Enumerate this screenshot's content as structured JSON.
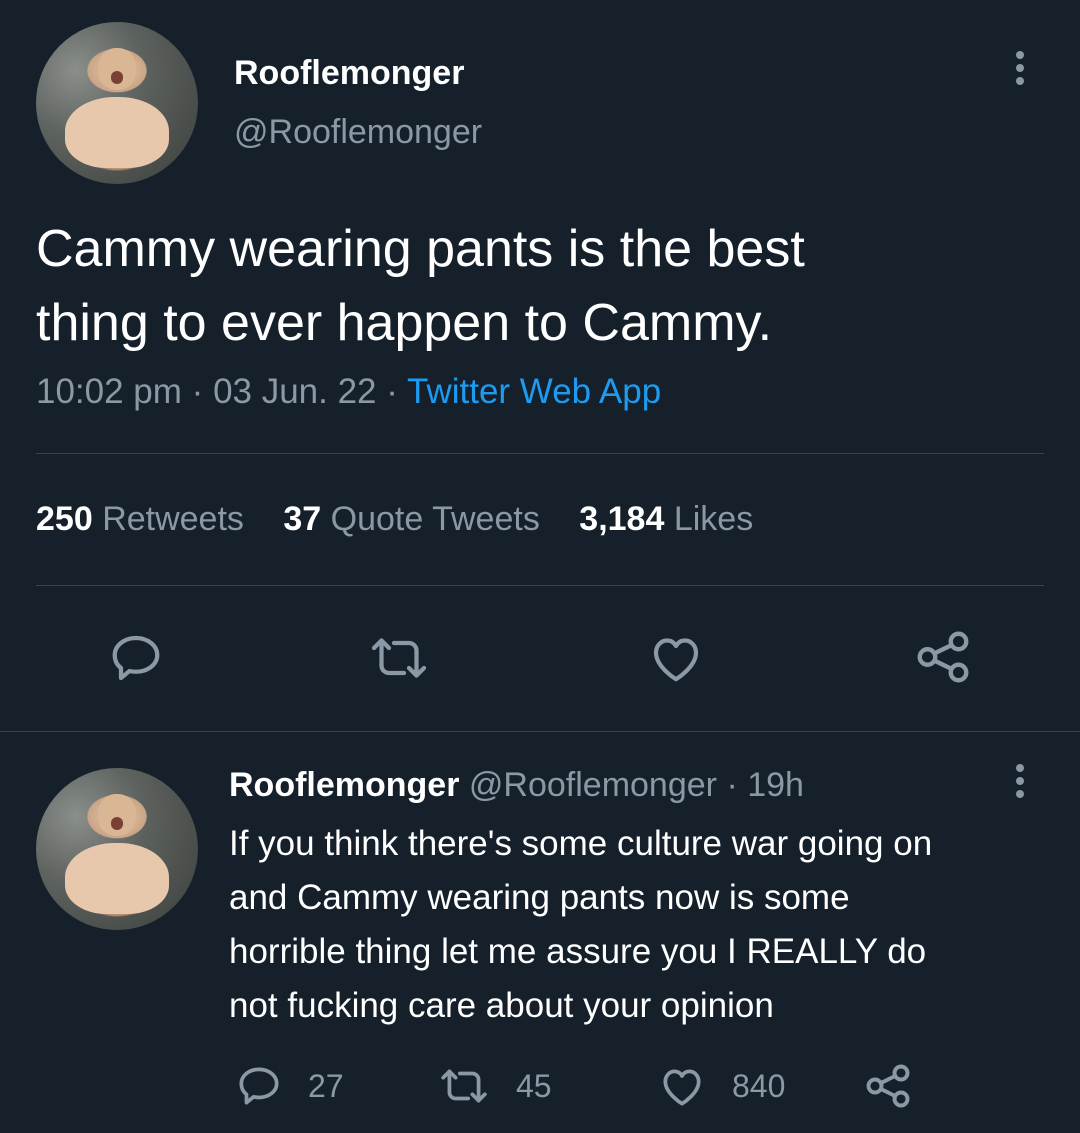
{
  "tweet": {
    "display_name": "Rooflemonger",
    "handle": "@Rooflemonger",
    "text_line1": "Cammy wearing pants is the best",
    "text_line2": "thing to ever happen to Cammy.",
    "time": "10:02 pm",
    "sep1": "·",
    "date": "03 Jun. 22",
    "sep2": "·",
    "source": "Twitter Web App",
    "stats": {
      "retweets_count": "250",
      "retweets_label": "Retweets",
      "quotes_count": "37",
      "quotes_label": "Quote Tweets",
      "likes_count": "3,184",
      "likes_label": "Likes"
    }
  },
  "reply": {
    "display_name": "Rooflemonger",
    "handle": "@Rooflemonger",
    "sep": "·",
    "age": "19h",
    "line1": "If you think there's some culture war going on",
    "line2": "and Cammy wearing pants now is some",
    "line3": "horrible thing let me assure you I REALLY do",
    "line4": "not fucking care about your opinion",
    "replies": "27",
    "retweets": "45",
    "likes": "840"
  },
  "icons": [
    "reply-icon",
    "retweet-icon",
    "like-icon",
    "share-icon",
    "more-icon"
  ],
  "colors": {
    "background": "#15202b",
    "text": "#ffffff",
    "secondary": "#8b98a5",
    "link": "#1d9bf0",
    "divider": "#38444d"
  }
}
